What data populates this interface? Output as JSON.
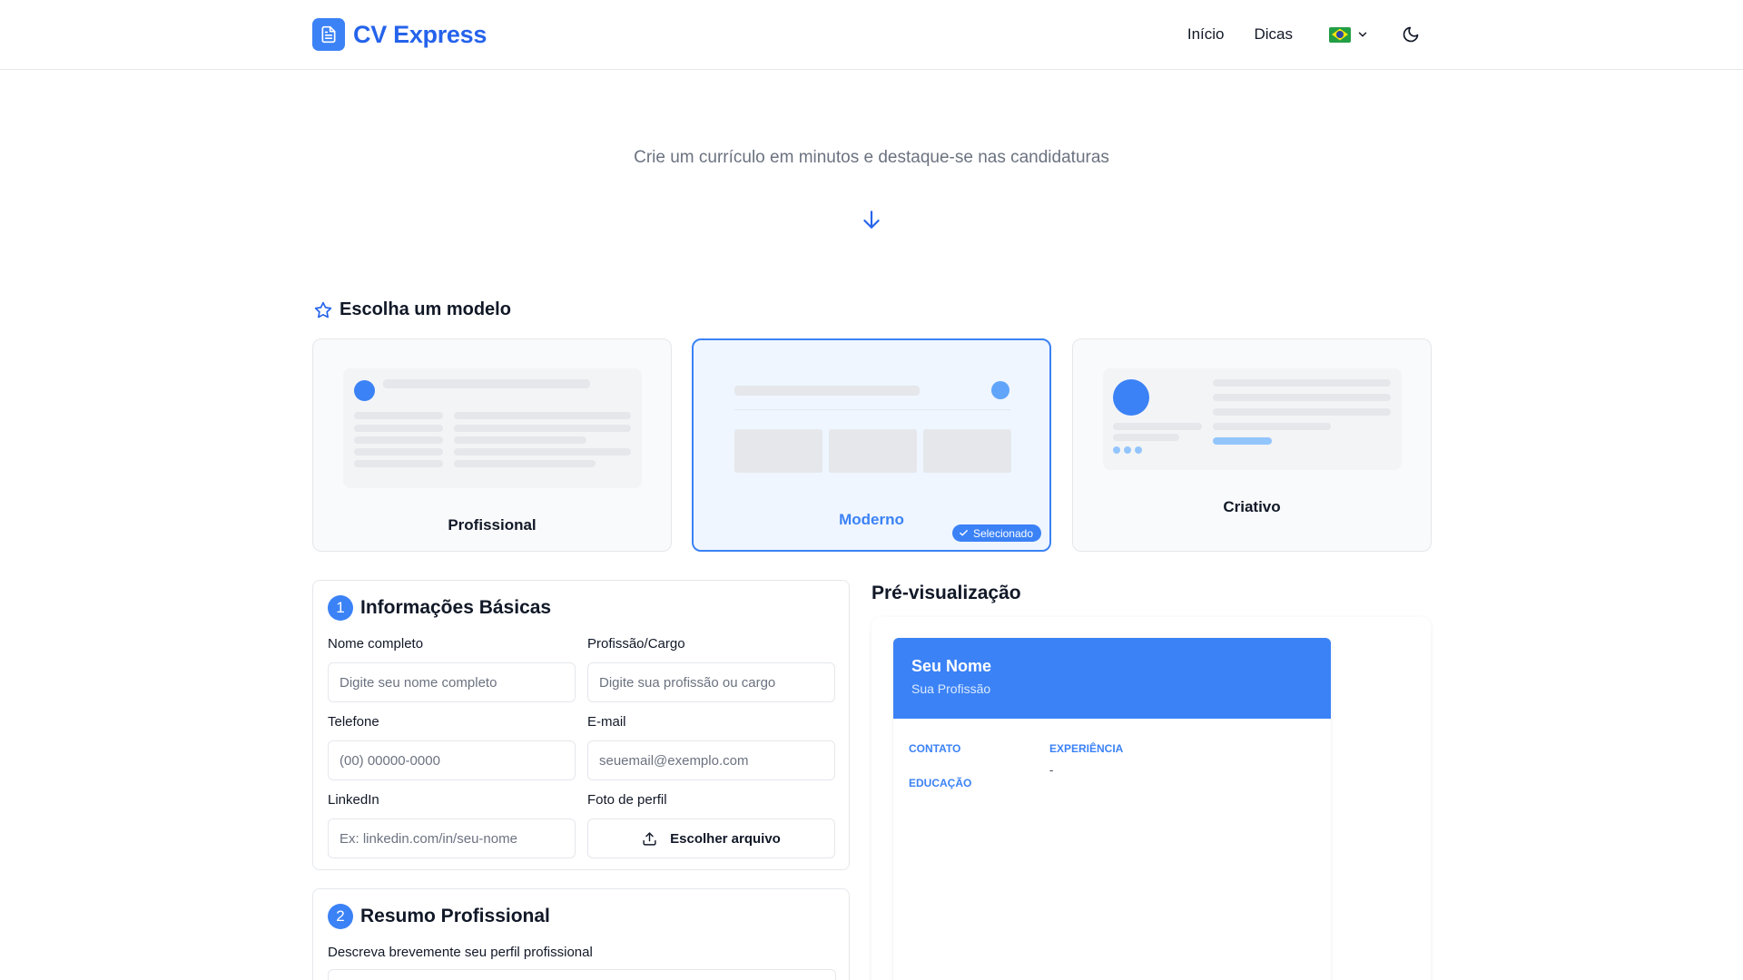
{
  "header": {
    "brand": "CV Express",
    "nav": [
      {
        "label": "Início"
      },
      {
        "label": "Dicas"
      }
    ],
    "language_icon": "brazil-flag-icon",
    "theme_icon": "moon-icon"
  },
  "hero": {
    "subtitle": "Crie um currículo em minutos e destaque-se nas candidaturas"
  },
  "templates": {
    "title": "Escolha um modelo",
    "items": [
      {
        "name": "Profissional"
      },
      {
        "name": "Moderno",
        "selected": true,
        "badge": "Selecionado"
      },
      {
        "name": "Criativo"
      }
    ]
  },
  "basic_info": {
    "step": "1",
    "title": "Informações Básicas",
    "name": {
      "label": "Nome completo",
      "placeholder": "Digite seu nome completo"
    },
    "profession": {
      "label": "Profissão/Cargo",
      "placeholder": "Digite sua profissão ou cargo"
    },
    "phone": {
      "label": "Telefone",
      "placeholder": "(00) 00000-0000"
    },
    "email": {
      "label": "E-mail",
      "placeholder": "seuemail@exemplo.com"
    },
    "linkedin": {
      "label": "LinkedIn",
      "placeholder": "Ex: linkedin.com/in/seu-nome"
    },
    "photo": {
      "label": "Foto de perfil",
      "button": "Escolher arquivo"
    }
  },
  "summary": {
    "step": "2",
    "title": "Resumo Profissional",
    "label": "Descreva brevemente seu perfil profissional"
  },
  "preview": {
    "title": "Pré-visualização",
    "name": "Seu Nome",
    "profession": "Sua Profissão",
    "contact": "CONTATO",
    "education": "EDUCAÇÃO",
    "experience": "EXPERIÊNCIA",
    "experience_value": "-"
  },
  "colors": {
    "accent": "#3b82f6",
    "brand_text": "#2563eb",
    "muted": "#6b7280",
    "border": "#e5e7eb"
  }
}
